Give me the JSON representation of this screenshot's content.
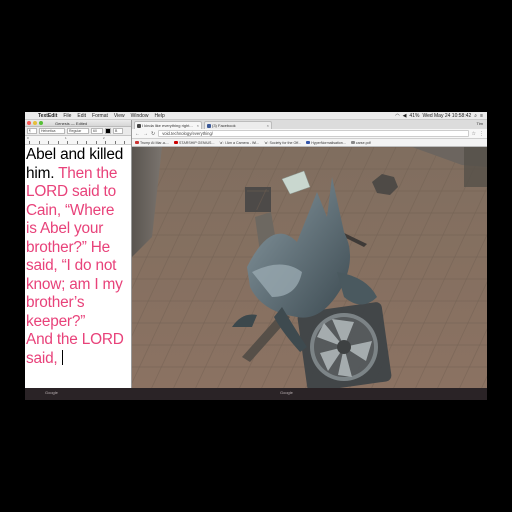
{
  "menubar": {
    "app_name": "TextEdit",
    "menus": [
      "File",
      "Edit",
      "Format",
      "View",
      "Window",
      "Help"
    ],
    "datetime": "Wed May 24 10:58:42",
    "battery": "41%",
    "user": "Tim"
  },
  "textedit": {
    "title": "Genesis — Edited",
    "font_family": "Helvetica",
    "font_style": "Regular",
    "font_size": "60",
    "ruler_numbers": [
      "0",
      "1",
      "2"
    ],
    "lines": [
      {
        "text": "Abel and killed",
        "color": "black"
      },
      {
        "text": "him. ",
        "color": "black",
        "tail": "Then the"
      },
      {
        "text": "LORD said to",
        "color": "pink"
      },
      {
        "text": "Cain, “Where",
        "color": "pink"
      },
      {
        "text": "is Abel your",
        "color": "pink"
      },
      {
        "text": "brother?” He",
        "color": "pink"
      },
      {
        "text": "said, “I do not",
        "color": "pink"
      },
      {
        "text": "know; am I my",
        "color": "pink"
      },
      {
        "text": "brother’s",
        "color": "pink"
      },
      {
        "text": "keeper?”",
        "color": "pink"
      },
      {
        "text": "And the LORD",
        "color": "pink"
      },
      {
        "text": "said, ",
        "color": "pink"
      }
    ],
    "colors": {
      "text": "#000000",
      "highlight": "#e8427a"
    }
  },
  "chrome": {
    "tabs": [
      {
        "label": "I kinda like everything right...",
        "active": true,
        "favicon_color": "#444444"
      },
      {
        "label": "(3) Facebook",
        "active": false,
        "favicon_color": "#3b5998"
      }
    ],
    "url": "void.technology/everything/",
    "bookmarks": [
      {
        "label": "Trump At Mar-a-...",
        "color": "#cc3333"
      },
      {
        "label": "STARSHIP GENIUS...",
        "color": "#cc0000"
      },
      {
        "label": "'a': I Am a Camera - Wi...",
        "color": "#555555"
      },
      {
        "label": "'a': Society for the Off...",
        "color": "#555555"
      },
      {
        "label": "HyperNormalisation...",
        "color": "#3355aa"
      },
      {
        "label": "carse.pdf",
        "color": "#888888"
      }
    ]
  },
  "dock": {
    "labels": [
      "Google",
      "Google"
    ]
  }
}
